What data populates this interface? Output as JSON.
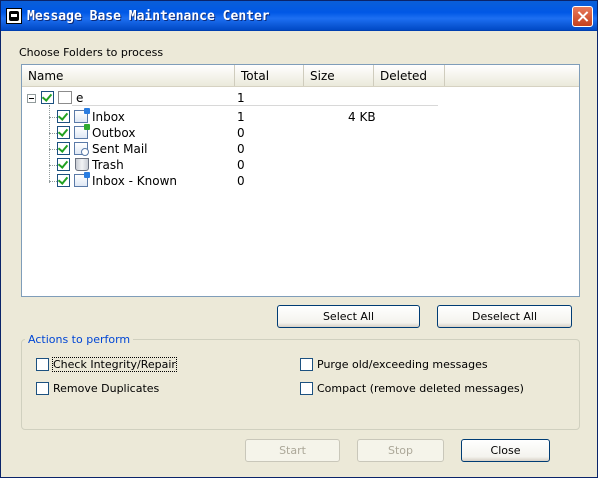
{
  "window": {
    "title": "Message Base Maintenance Center"
  },
  "folders_label": "Choose Folders to process",
  "columns": {
    "name": "Name",
    "total": "Total",
    "size": "Size",
    "deleted": "Deleted"
  },
  "tree": {
    "root": {
      "name": "e",
      "total": "1",
      "size": "",
      "checked": true,
      "expanded": true
    },
    "children": [
      {
        "name": "Inbox",
        "total": "1",
        "size": "4 KB",
        "icon": "inbox-folder-icon",
        "checked": true
      },
      {
        "name": "Outbox",
        "total": "0",
        "size": "",
        "icon": "outbox-folder-icon",
        "checked": true
      },
      {
        "name": "Sent Mail",
        "total": "0",
        "size": "",
        "icon": "sent-folder-icon",
        "checked": true
      },
      {
        "name": "Trash",
        "total": "0",
        "size": "",
        "icon": "trash-icon",
        "checked": true
      },
      {
        "name": "Inbox - Known",
        "total": "0",
        "size": "",
        "icon": "inbox-folder-icon",
        "checked": true
      }
    ]
  },
  "buttons": {
    "select_all": "Select All",
    "deselect_all": "Deselect All",
    "start": "Start",
    "stop": "Stop",
    "close": "Close"
  },
  "actions": {
    "title": "Actions to perform",
    "check_integrity": {
      "label": "Check Integrity/Repair",
      "checked": false
    },
    "remove_duplicates": {
      "label": "Remove Duplicates",
      "checked": false
    },
    "purge": {
      "label": "Purge old/exceeding messages",
      "checked": false
    },
    "compact": {
      "label": "Compact (remove deleted messages)",
      "checked": false
    }
  },
  "colors": {
    "titlebar": "#0058e6",
    "dialog_bg": "#ece9d8",
    "group_title": "#0046d5",
    "check": "#21a121"
  }
}
